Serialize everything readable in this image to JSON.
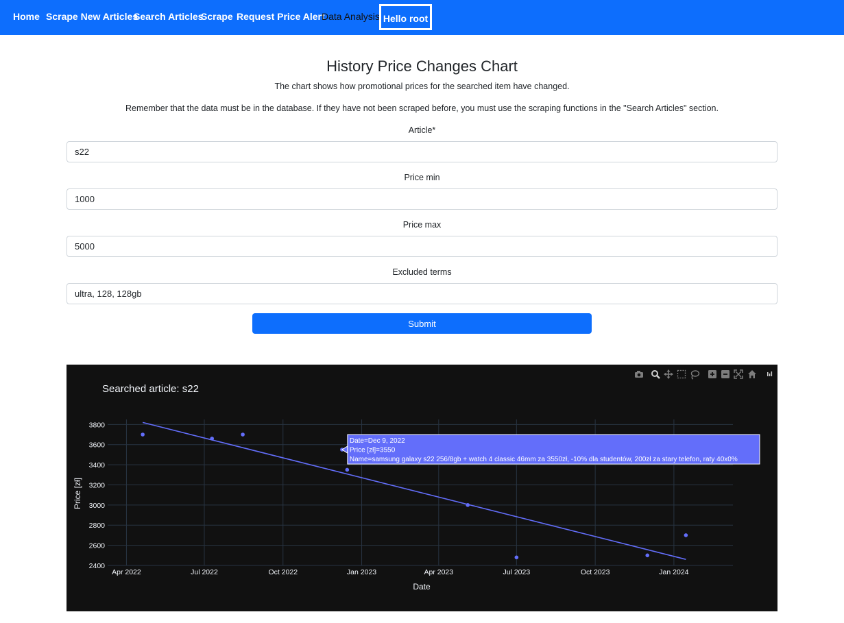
{
  "nav": {
    "items": [
      {
        "label": "Home",
        "style": "bold"
      },
      {
        "label": "Scrape New Articles",
        "style": "bold"
      },
      {
        "label": "Search Articles",
        "style": "bold"
      },
      {
        "label": "Scrape",
        "style": "bold"
      },
      {
        "label": "Request Price Alert",
        "style": "bold"
      },
      {
        "label": "Data Analysis",
        "style": "plain"
      }
    ],
    "greeting": "Hello root",
    "bg_color": "#0d6efd"
  },
  "page": {
    "title": "History Price Changes Chart",
    "desc1": "The chart shows how promotional prices for the searched item have changed.",
    "desc2": "Remember that the data must be in the database. If they have not been scraped before, you must use the scraping functions in the \"Search Articles\" section."
  },
  "form": {
    "article_label": "Article*",
    "article_value": "s22",
    "price_min_label": "Price min",
    "price_min_value": "1000",
    "price_max_label": "Price max",
    "price_max_value": "5000",
    "excluded_label": "Excluded terms",
    "excluded_value": "ultra, 128, 128gb",
    "submit_label": "Submit"
  },
  "toolbar": {
    "icons": [
      "camera-icon",
      "zoom-icon",
      "pan-icon",
      "box-select-icon",
      "lasso-select-icon",
      "zoom-in-icon",
      "zoom-out-icon",
      "autoscale-icon",
      "reset-axes-icon",
      "plotly-logo-icon"
    ]
  },
  "chart_data": {
    "type": "scatter",
    "title": "Searched article: s22",
    "xlabel": "Date",
    "ylabel": "Price [zł]",
    "x_ticks": [
      "Apr 2022",
      "Jul 2022",
      "Oct 2022",
      "Jan 2023",
      "Apr 2023",
      "Jul 2023",
      "Oct 2023",
      "Jan 2024"
    ],
    "y_ticks": [
      "2400",
      "2600",
      "2800",
      "3000",
      "3200",
      "3400",
      "3600",
      "3800"
    ],
    "xlim": [
      "2022-03-10",
      "2024-03-10"
    ],
    "ylim": [
      2400,
      3850
    ],
    "grid": true,
    "background": "#111111",
    "marker_color": "#636efa",
    "points": [
      {
        "x": "2022-04-20",
        "y": 3700
      },
      {
        "x": "2022-07-10",
        "y": 3660
      },
      {
        "x": "2022-08-15",
        "y": 3700
      },
      {
        "x": "2022-12-09",
        "y": 3550
      },
      {
        "x": "2022-12-15",
        "y": 3350
      },
      {
        "x": "2023-05-05",
        "y": 3000
      },
      {
        "x": "2023-07-01",
        "y": 2480
      },
      {
        "x": "2023-12-01",
        "y": 2500
      },
      {
        "x": "2024-01-15",
        "y": 2700
      }
    ],
    "trendline": [
      {
        "x": "2022-04-20",
        "y": 3820
      },
      {
        "x": "2024-01-15",
        "y": 2460
      }
    ],
    "hover": {
      "point_index": 3,
      "lines": [
        "Date=Dec 9, 2022",
        "Price [zł]=3550",
        "Name=samsung galaxy s22 256/8gb + watch 4 classic 46mm za 3550zł, -10% dla studentów, 200zł za stary telefon, raty 40x0%"
      ]
    }
  }
}
